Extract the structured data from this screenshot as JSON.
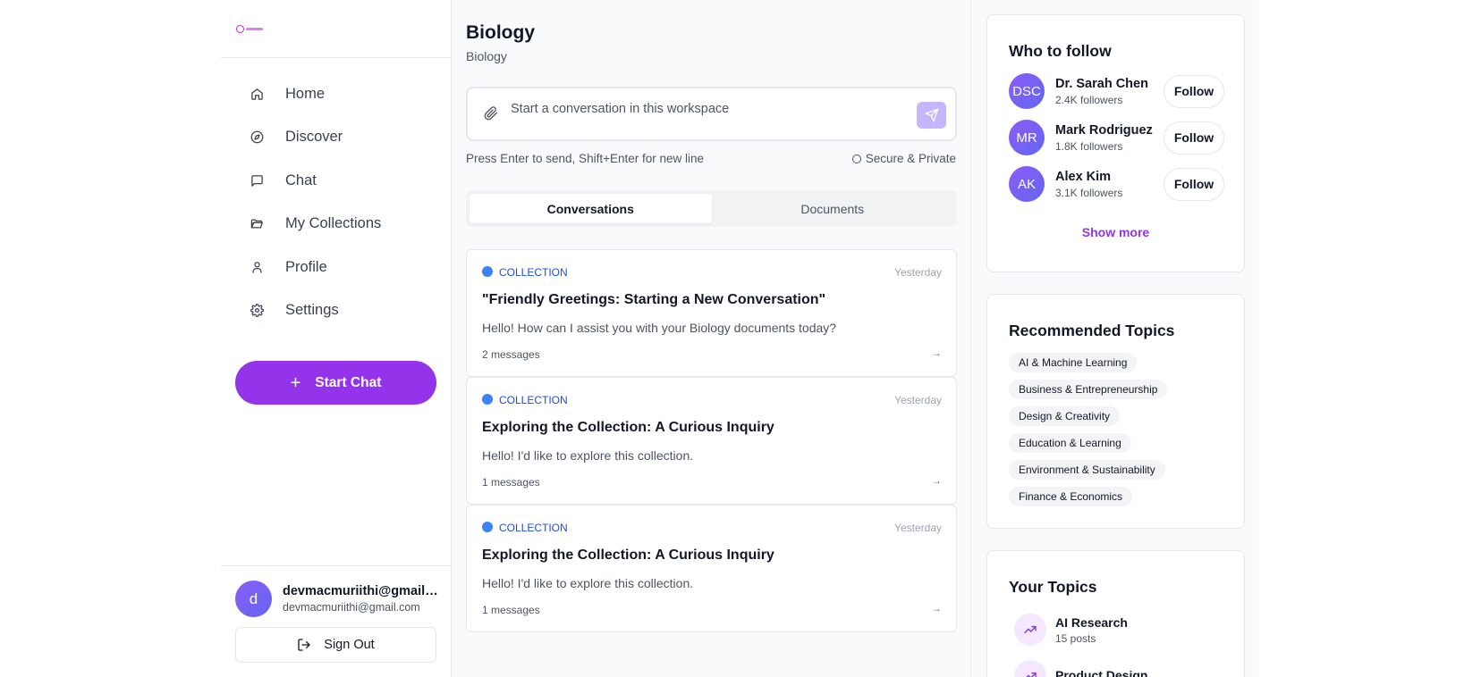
{
  "sidebar": {
    "nav": [
      {
        "label": "Home",
        "icon": "home-icon"
      },
      {
        "label": "Discover",
        "icon": "compass-icon"
      },
      {
        "label": "Chat",
        "icon": "chat-icon"
      },
      {
        "label": "My Collections",
        "icon": "folder-icon"
      },
      {
        "label": "Profile",
        "icon": "user-icon"
      },
      {
        "label": "Settings",
        "icon": "gear-icon"
      }
    ],
    "start_chat_label": "Start Chat",
    "user": {
      "initial": "d",
      "name": "devmacmuriithi@gmail.c...",
      "email": "devmacmuriithi@gmail.com"
    },
    "sign_out_label": "Sign Out"
  },
  "main": {
    "title": "Biology",
    "subtitle": "Biology",
    "composer_placeholder": "Start a conversation in this workspace",
    "hint": "Press Enter to send, Shift+Enter for new line",
    "secure_label": "Secure & Private",
    "tabs": [
      {
        "label": "Conversations",
        "active": true
      },
      {
        "label": "Documents",
        "active": false
      }
    ],
    "conversations": [
      {
        "tag": "COLLECTION",
        "time": "Yesterday",
        "title": "\"Friendly Greetings: Starting a New Conversation\"",
        "preview": "Hello! How can I assist you with your Biology documents today?",
        "count": "2 messages"
      },
      {
        "tag": "COLLECTION",
        "time": "Yesterday",
        "title": "Exploring the Collection: A Curious Inquiry",
        "preview": "Hello! I'd like to explore this collection.",
        "count": "1 messages"
      },
      {
        "tag": "COLLECTION",
        "time": "Yesterday",
        "title": "Exploring the Collection: A Curious Inquiry",
        "preview": "Hello! I'd like to explore this collection.",
        "count": "1 messages"
      }
    ]
  },
  "right": {
    "who_to_follow": {
      "title": "Who to follow",
      "people": [
        {
          "initials": "DSC",
          "name": "Dr. Sarah Chen",
          "followers": "2.4K followers",
          "button": "Follow"
        },
        {
          "initials": "MR",
          "name": "Mark Rodriguez",
          "followers": "1.8K followers",
          "button": "Follow"
        },
        {
          "initials": "AK",
          "name": "Alex Kim",
          "followers": "3.1K followers",
          "button": "Follow"
        }
      ],
      "show_more": "Show more"
    },
    "recommended_topics": {
      "title": "Recommended Topics",
      "topics": [
        "AI & Machine Learning",
        "Business & Entrepreneurship",
        "Design & Creativity",
        "Education & Learning",
        "Environment & Sustainability",
        "Finance & Economics"
      ]
    },
    "your_topics": {
      "title": "Your Topics",
      "items": [
        {
          "name": "AI Research",
          "posts": "15 posts",
          "icon": "trending-up-icon"
        },
        {
          "name": "Product Design",
          "posts": "",
          "icon": "trending-up-icon"
        }
      ]
    }
  },
  "colors": {
    "accent": "#9333ea",
    "accent_light": "#c4b5fd",
    "collection_blue": "#3b82f6"
  }
}
